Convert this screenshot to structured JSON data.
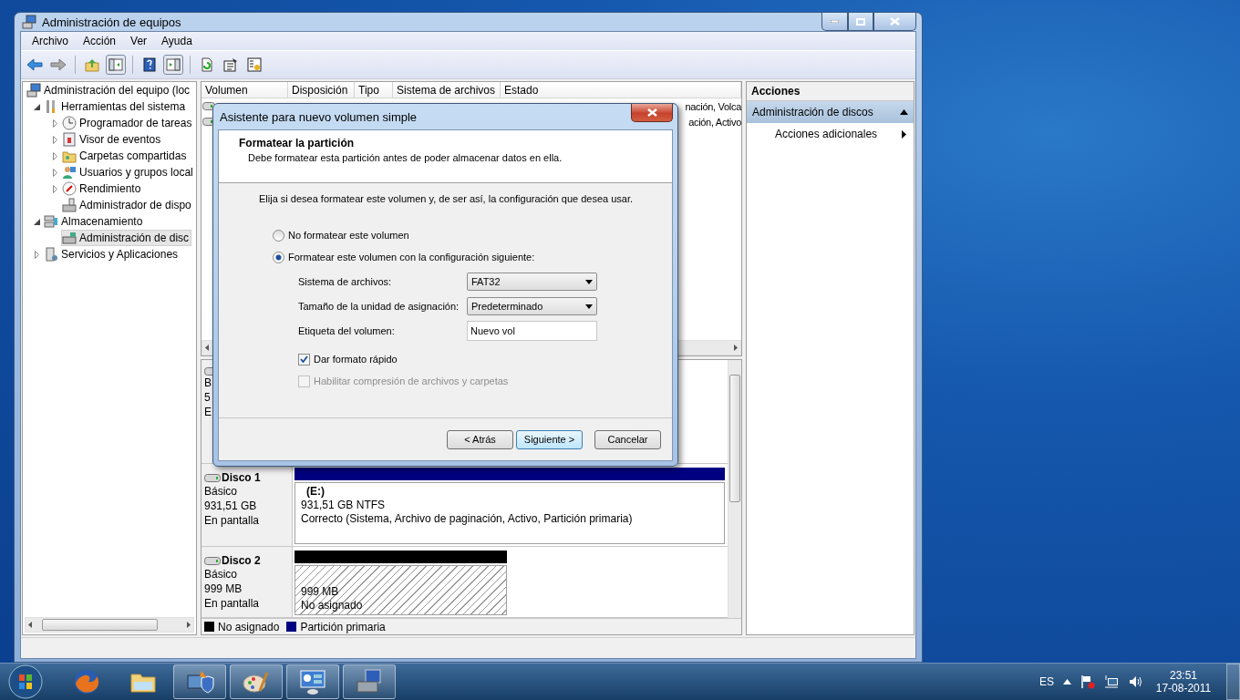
{
  "window": {
    "title": "Administración de equipos"
  },
  "menu": [
    "Archivo",
    "Acción",
    "Ver",
    "Ayuda"
  ],
  "tree": [
    {
      "label": "Administración del equipo (loc",
      "selected": false,
      "children": [
        {
          "label": "Herramientas del sistema",
          "expanded": true,
          "selected": false,
          "children": [
            {
              "label": "Programador de tareas",
              "expanded": false,
              "selected": false
            },
            {
              "label": "Visor de eventos",
              "expanded": false,
              "selected": false
            },
            {
              "label": "Carpetas compartidas",
              "expanded": false,
              "selected": false
            },
            {
              "label": "Usuarios y grupos local",
              "expanded": false,
              "selected": false
            },
            {
              "label": "Rendimiento",
              "expanded": false,
              "selected": false
            },
            {
              "label": "Administrador de dispo",
              "selected": false
            }
          ]
        },
        {
          "label": "Almacenamiento",
          "expanded": true,
          "selected": false,
          "children": [
            {
              "label": "Administración de disc",
              "selected": true
            }
          ]
        },
        {
          "label": "Servicios y Aplicaciones",
          "expanded": false,
          "selected": false
        }
      ]
    }
  ],
  "table": {
    "columns": [
      "Volumen",
      "Disposición",
      "Tipo",
      "Sistema de archivos",
      "Estado"
    ],
    "rows": [
      {
        "estado": "nación, Volca"
      },
      {
        "estado": "ación, Activo"
      }
    ]
  },
  "disks": [
    {
      "info": [
        "B",
        "5",
        "E"
      ]
    },
    {
      "name": "Disco 1",
      "info": [
        "Básico",
        "931,51 GB",
        "En pantalla"
      ],
      "partitions": [
        {
          "kind": "primary",
          "label": "(E:)",
          "lines": [
            "931,51 GB NTFS",
            "Correcto (Sistema, Archivo de paginación, Activo, Partición primaria)"
          ]
        }
      ]
    },
    {
      "name": "Disco 2",
      "info": [
        "Básico",
        "999 MB",
        "En pantalla"
      ],
      "partitions": [
        {
          "kind": "unallocated",
          "lines": [
            "999 MB",
            "No asignado"
          ]
        }
      ]
    }
  ],
  "legend": [
    {
      "label": "No asignado",
      "color": "#000000"
    },
    {
      "label": "Partición primaria",
      "color": "#000080"
    }
  ],
  "actions": {
    "title": "Acciones",
    "sections": [
      {
        "label": "Administración de discos",
        "expanded": true,
        "items": [
          "Acciones adicionales"
        ]
      }
    ]
  },
  "dialog": {
    "title": "Asistente para nuevo volumen simple",
    "heading": "Formatear la partición",
    "subheading": "Debe formatear esta partición antes de poder almacenar datos en ella.",
    "prompt": "Elija si desea formatear este volumen y, de ser así, la configuración que desea usar.",
    "options": [
      {
        "label": "No formatear este volumen",
        "selected": false
      },
      {
        "label": "Formatear este volumen con la configuración siguiente:",
        "selected": true
      }
    ],
    "fields": [
      {
        "kind": "select",
        "label": "Sistema de archivos:",
        "value": "FAT32"
      },
      {
        "kind": "select",
        "label": "Tamaño de la unidad de asignación:",
        "value": "Predeterminado"
      },
      {
        "kind": "text",
        "label": "Etiqueta del volumen:",
        "value": "Nuevo vol"
      }
    ],
    "checkboxes": [
      {
        "label": "Dar formato rápido",
        "checked": true,
        "disabled": false
      },
      {
        "label": "Habilitar compresión de archivos y carpetas",
        "checked": false,
        "disabled": true
      }
    ],
    "buttons": [
      {
        "label": "< Atrás",
        "default": false
      },
      {
        "label": "Siguiente >",
        "default": true
      },
      {
        "label": "Cancelar",
        "default": false
      }
    ]
  },
  "taskbar": {
    "items": [
      {
        "running": false
      },
      {
        "running": false
      },
      {
        "running": true
      },
      {
        "running": true
      },
      {
        "running": true
      },
      {
        "running": true
      }
    ],
    "language": "ES",
    "time": "23:51",
    "date": "17-08-2011"
  }
}
